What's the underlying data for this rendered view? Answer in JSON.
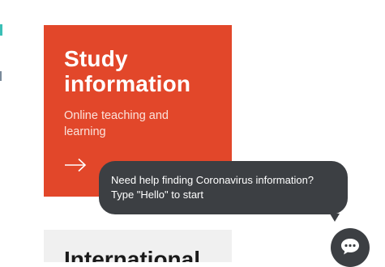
{
  "study_card": {
    "title_line1": "Study",
    "title_line2": "information",
    "subtitle": "Online teaching and learning",
    "arrow_icon": "arrow-right-icon"
  },
  "intl_card": {
    "title": "International"
  },
  "chat": {
    "message_line1": "Need help finding Coronavirus information?",
    "message_line2": "Type \"Hello\" to start",
    "launcher_icon": "chat-bubble-icon"
  },
  "colors": {
    "card_accent": "#e2472a",
    "chat_background": "#3c3f43",
    "intl_card_background": "#f0f0f0"
  }
}
